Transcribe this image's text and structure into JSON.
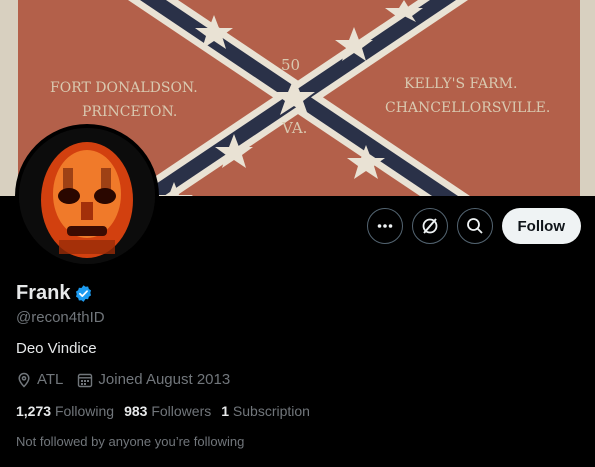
{
  "banner": {
    "flag_text_left_1": "FORT DONALDSON.",
    "flag_text_left_2": "PRINCETON.",
    "flag_text_right_1": "KELLY'S FARM.",
    "flag_text_right_2": "CHANCELLORSVILLE.",
    "flag_text_center_1": "50",
    "flag_text_center_2": "VA."
  },
  "actions": {
    "more_icon": "more-horizontal-icon",
    "grok_icon": "grok-icon",
    "search_icon": "search-icon",
    "follow_label": "Follow"
  },
  "profile": {
    "name": "Frank",
    "verified_icon": "verified-badge-icon",
    "verified_color": "#1d9bf0",
    "handle": "@recon4thID",
    "bio": "Deo Vindice",
    "location": "ATL",
    "joined": "Joined August 2013"
  },
  "stats": {
    "following_count": "1,273",
    "following_label": "Following",
    "followers_count": "983",
    "followers_label": "Followers",
    "subscription_count": "1",
    "subscription_label": "Subscription"
  },
  "followed_note": "Not followed by anyone you’re following"
}
